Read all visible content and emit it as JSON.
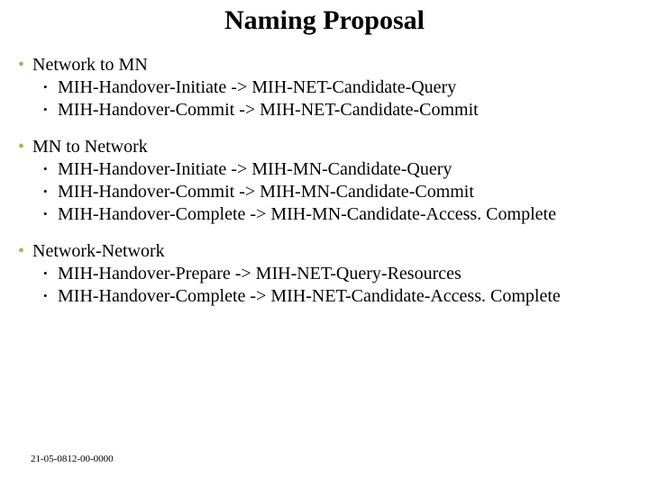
{
  "title": "Naming Proposal",
  "sections": [
    {
      "heading": "Network to MN",
      "items": [
        "MIH-Handover-Initiate -> MIH-NET-Candidate-Query",
        "MIH-Handover-Commit -> MIH-NET-Candidate-Commit"
      ]
    },
    {
      "heading": "MN to Network",
      "items": [
        "MIH-Handover-Initiate -> MIH-MN-Candidate-Query",
        "MIH-Handover-Commit -> MIH-MN-Candidate-Commit",
        "MIH-Handover-Complete -> MIH-MN-Candidate-Access. Complete"
      ]
    },
    {
      "heading": "Network-Network",
      "items": [
        "MIH-Handover-Prepare -> MIH-NET-Query-Resources",
        "MIH-Handover-Complete -> MIH-NET-Candidate-Access. Complete"
      ]
    }
  ],
  "footer": "21-05-0812-00-0000"
}
